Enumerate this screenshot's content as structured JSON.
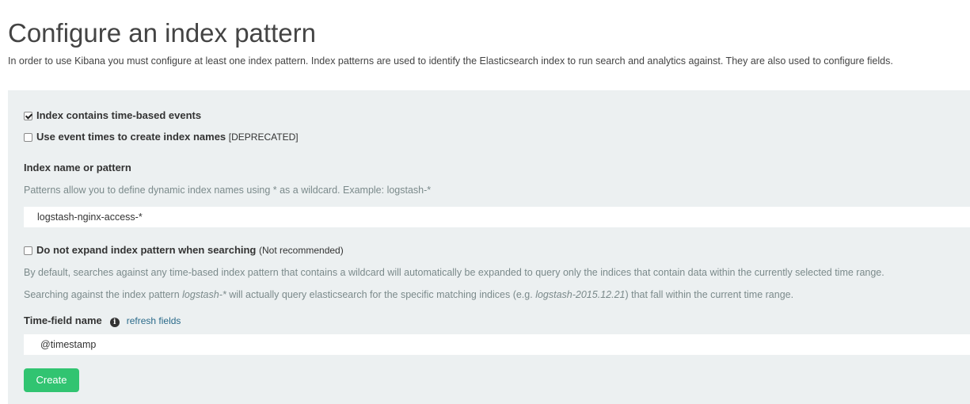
{
  "page": {
    "title": "Configure an index pattern",
    "intro": "In order to use Kibana you must configure at least one index pattern. Index patterns are used to identify the Elasticsearch index to run search and analytics against. They are also used to configure fields."
  },
  "form": {
    "time_based": {
      "checked": true,
      "label": "Index contains time-based events"
    },
    "event_times": {
      "checked": false,
      "label": "Use event times to create index names",
      "note": "[DEPRECATED]"
    },
    "index_name": {
      "label": "Index name or pattern",
      "help": "Patterns allow you to define dynamic index names using * as a wildcard. Example: logstash-*",
      "value": "logstash-nginx-access-*"
    },
    "no_expand": {
      "checked": false,
      "label": "Do not expand index pattern when searching",
      "note": "(Not recommended)",
      "help_1": "By default, searches against any time-based index pattern that contains a wildcard will automatically be expanded to query only the indices that contain data within the currently selected time range.",
      "help_2_prefix": "Searching against the index pattern ",
      "help_2_pattern": "logstash-*",
      "help_2_middle": " will actually query elasticsearch for the specific matching indices (e.g. ",
      "help_2_example": "logstash-2015.12.21",
      "help_2_suffix": ") that fall within the current time range."
    },
    "time_field": {
      "label": "Time-field name",
      "info_icon": "i",
      "refresh_label": "refresh fields",
      "value": "@timestamp"
    },
    "create_label": "Create"
  },
  "colors": {
    "panel_bg": "#ecf0f1",
    "create_button": "#31c471",
    "link": "#2a6a8a",
    "help_text": "#7b8a8b"
  }
}
